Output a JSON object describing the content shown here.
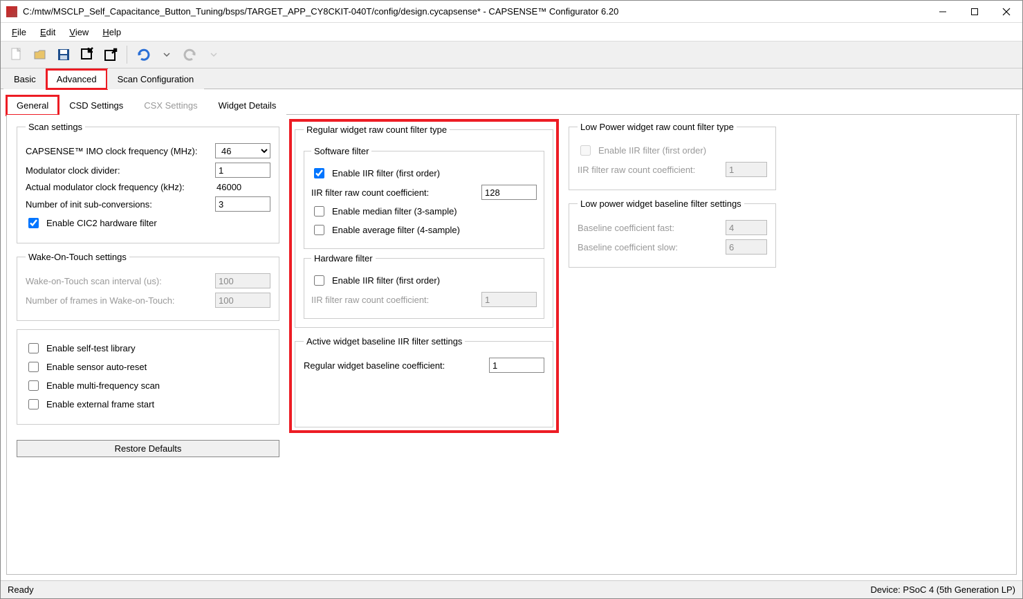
{
  "window": {
    "title": "C:/mtw/MSCLP_Self_Capacitance_Button_Tuning/bsps/TARGET_APP_CY8CKIT-040T/config/design.cycapsense* - CAPSENSE™ Configurator 6.20"
  },
  "menu": {
    "file": "File",
    "edit": "Edit",
    "view": "View",
    "help": "Help"
  },
  "main_tabs": {
    "basic": "Basic",
    "advanced": "Advanced",
    "scan_config": "Scan Configuration"
  },
  "sub_tabs": {
    "general": "General",
    "csd": "CSD Settings",
    "csx": "CSX Settings",
    "widget": "Widget Details"
  },
  "scan_settings": {
    "legend": "Scan settings",
    "imo_label": "CAPSENSE™ IMO clock frequency (MHz):",
    "imo_value": "46",
    "mod_div_label": "Modulator clock divider:",
    "mod_div_value": "1",
    "actual_freq_label": "Actual modulator clock frequency (kHz):",
    "actual_freq_value": "46000",
    "init_sub_label": "Number of init sub-conversions:",
    "init_sub_value": "3",
    "cic2_label": "Enable CIC2 hardware filter"
  },
  "wot": {
    "legend": "Wake-On-Touch settings",
    "interval_label": "Wake-on-Touch scan interval (us):",
    "interval_value": "100",
    "frames_label": "Number of frames in Wake-on-Touch:",
    "frames_value": "100"
  },
  "misc": {
    "selftest": "Enable self-test library",
    "autoreset": "Enable sensor auto-reset",
    "multifreq": "Enable multi-frequency scan",
    "extframe": "Enable external frame start",
    "restore": "Restore Defaults"
  },
  "reg_filter": {
    "legend": "Regular widget raw count filter type",
    "sw_legend": "Software filter",
    "sw_iir_label": "Enable IIR filter (first order)",
    "sw_coef_label": "IIR filter raw count coefficient:",
    "sw_coef_value": "128",
    "sw_median_label": "Enable median filter (3-sample)",
    "sw_avg_label": "Enable average filter (4-sample)",
    "hw_legend": "Hardware filter",
    "hw_iir_label": "Enable IIR filter (first order)",
    "hw_coef_label": "IIR filter raw count coefficient:",
    "hw_coef_value": "1"
  },
  "active_baseline": {
    "legend": "Active widget baseline IIR filter settings",
    "coef_label": "Regular widget baseline coefficient:",
    "coef_value": "1"
  },
  "lp_filter": {
    "legend": "Low Power widget raw count filter type",
    "iir_label": "Enable IIR filter (first order)",
    "coef_label": "IIR filter raw count coefficient:",
    "coef_value": "1"
  },
  "lp_baseline": {
    "legend": "Low power widget baseline filter settings",
    "fast_label": "Baseline coefficient fast:",
    "fast_value": "4",
    "slow_label": "Baseline coefficient slow:",
    "slow_value": "6"
  },
  "status": {
    "ready": "Ready",
    "device": "Device: PSoC 4 (5th Generation LP)"
  }
}
